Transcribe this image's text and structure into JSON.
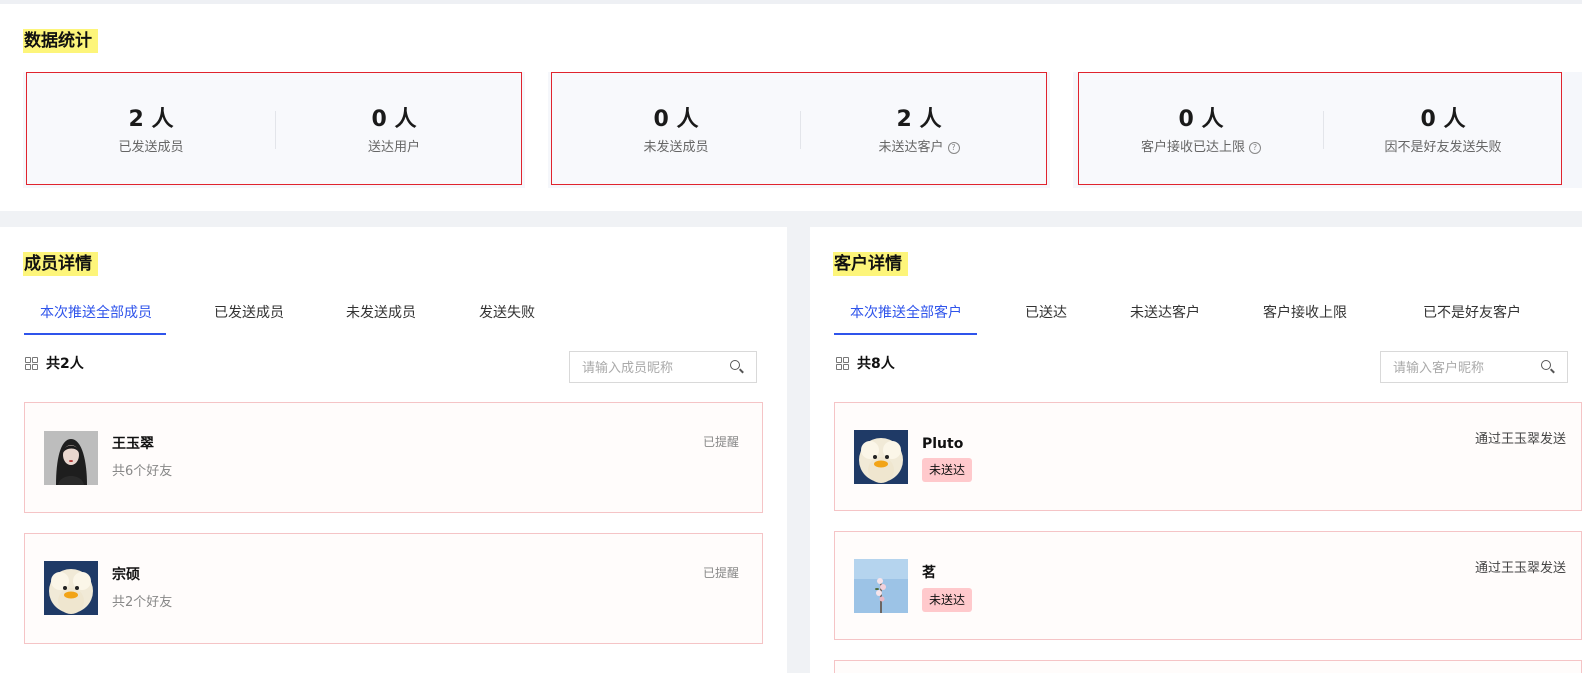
{
  "stats": {
    "title": "数据统计",
    "cards": [
      {
        "left": {
          "value": "2 人",
          "label": "已发送成员"
        },
        "right": {
          "value": "0 人",
          "label": "送达用户"
        }
      },
      {
        "left": {
          "value": "0 人",
          "label": "未发送成员"
        },
        "right": {
          "value": "2 人",
          "label": "未送达客户",
          "help": "?"
        }
      },
      {
        "left": {
          "value": "0 人",
          "label": "客户接收已达上限",
          "help": "?"
        },
        "right": {
          "value": "0 人",
          "label": "因不是好友发送失败"
        }
      }
    ]
  },
  "members": {
    "title": "成员详情",
    "tabs": [
      "本次推送全部成员",
      "已发送成员",
      "未发送成员",
      "发送失败"
    ],
    "active_tab": "本次推送全部成员",
    "count": "共2人",
    "search_placeholder": "请输入成员昵称",
    "items": [
      {
        "name": "王玉翠",
        "sub": "共6个好友",
        "status": "已提醒",
        "avatar": "woman-portrait"
      },
      {
        "name": "宗硕",
        "sub": "共2个好友",
        "status": "已提醒",
        "avatar": "fluffy-duck"
      }
    ]
  },
  "customers": {
    "title": "客户详情",
    "tabs": [
      "本次推送全部客户",
      "已送达",
      "未送达客户",
      "客户接收上限",
      "已不是好友客户"
    ],
    "active_tab": "本次推送全部客户",
    "count": "共8人",
    "search_placeholder": "请输入客户昵称",
    "items": [
      {
        "name": "Pluto",
        "badge": "未送达",
        "via": "通过王玉翠发送",
        "avatar": "fluffy-duck"
      },
      {
        "name": "茗",
        "badge": "未送达",
        "via": "通过王玉翠发送",
        "avatar": "blossom-sky"
      }
    ]
  },
  "colors": {
    "accent": "#2f54eb",
    "highlight": "#fdf57a",
    "card_border": "#e0242e",
    "badge_bg": "#ffc9cc"
  }
}
